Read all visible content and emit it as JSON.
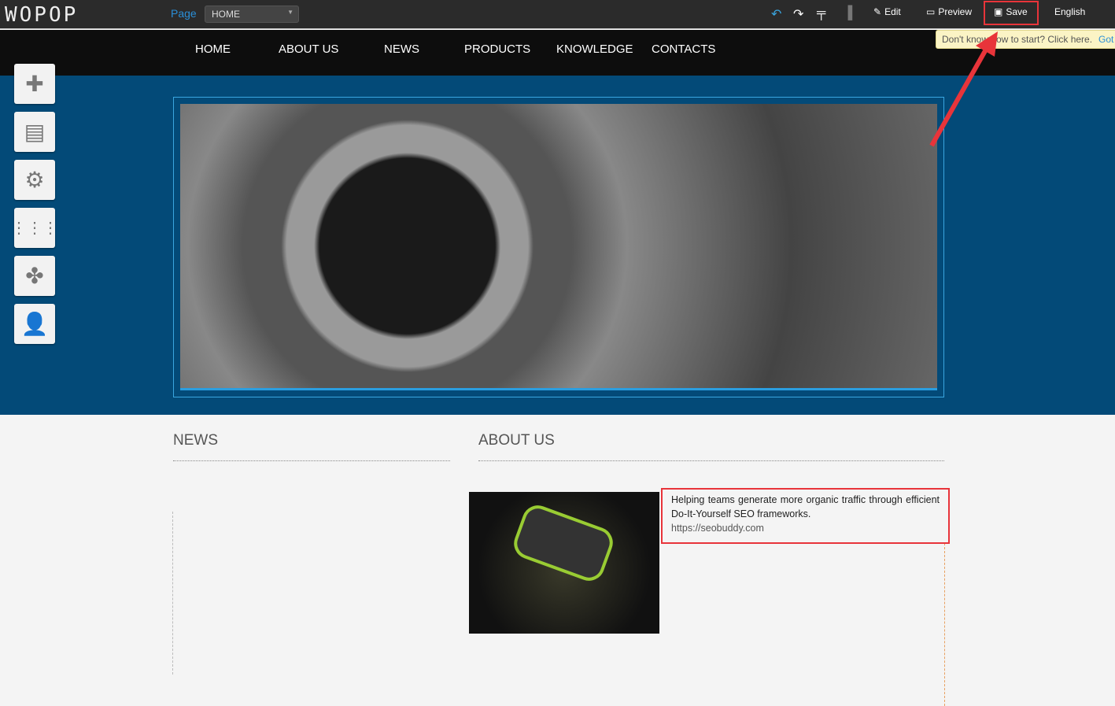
{
  "topbar": {
    "logo": "WOPOP",
    "page_label": "Page",
    "page_value": "HOME",
    "edit": "Edit",
    "preview": "Preview",
    "save": "Save",
    "language": "English"
  },
  "tooltip": {
    "text": "Don't know how to start? Click here.",
    "action": "Got"
  },
  "nav": [
    "HOME",
    "ABOUT US",
    "NEWS",
    "PRODUCTS",
    "KNOWLEDGE",
    "CONTACTS"
  ],
  "sections": {
    "news": "NEWS",
    "about": "ABOUT US"
  },
  "about": {
    "text": "Helping teams generate more organic traffic through efficient Do-It-Yourself SEO frameworks.",
    "link": "https://seobuddy.com"
  },
  "colors": {
    "accent": "#2a8fd8",
    "highlight": "#e8343a",
    "hero": "#034a78"
  }
}
